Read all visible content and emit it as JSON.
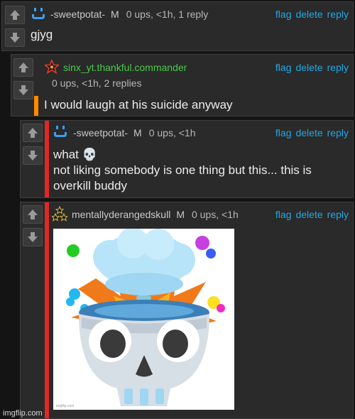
{
  "comments": [
    {
      "avatar": "blue-smiley-icon",
      "username": "-sweetpotat-",
      "mod_badge": "M",
      "stats": "0 ups, <1h, 1 reply",
      "body_lines": [
        "gjyg"
      ],
      "actions": {
        "flag": "flag",
        "delete": "delete",
        "reply": "reply"
      }
    },
    {
      "avatar": "red-star-icon",
      "username": "sinx_yt.thankful.commander",
      "mod_badge": "",
      "stats": "0 ups, <1h, 2 replies",
      "body_lines": [
        "I would laugh at his suicide anyway"
      ],
      "accent": "#ff8a00",
      "actions": {
        "flag": "flag",
        "delete": "delete",
        "reply": "reply"
      }
    },
    {
      "avatar": "blue-smiley-icon",
      "username": "-sweetpotat-",
      "mod_badge": "M",
      "stats": "0 ups, <1h",
      "body_lines": [
        "what 💀",
        "not liking somebody is one thing but this... this is",
        "overkill buddy"
      ],
      "accent": "#e02828",
      "actions": {
        "flag": "flag",
        "delete": "delete",
        "reply": "reply"
      }
    },
    {
      "avatar": "star-cluster-icon",
      "username": "mentallyderangedskull",
      "mod_badge": "M",
      "stats": "0 ups, <1h",
      "image": "exploding-head-skull-emoji",
      "image_caption": "imgflip.com",
      "accent": "#e02828",
      "actions": {
        "flag": "flag",
        "delete": "delete",
        "reply": "reply"
      }
    }
  ],
  "footer": "imgflip.com",
  "colors": {
    "link": "#22a8e6",
    "background": "#141414",
    "panel": "#2a2a2a"
  }
}
